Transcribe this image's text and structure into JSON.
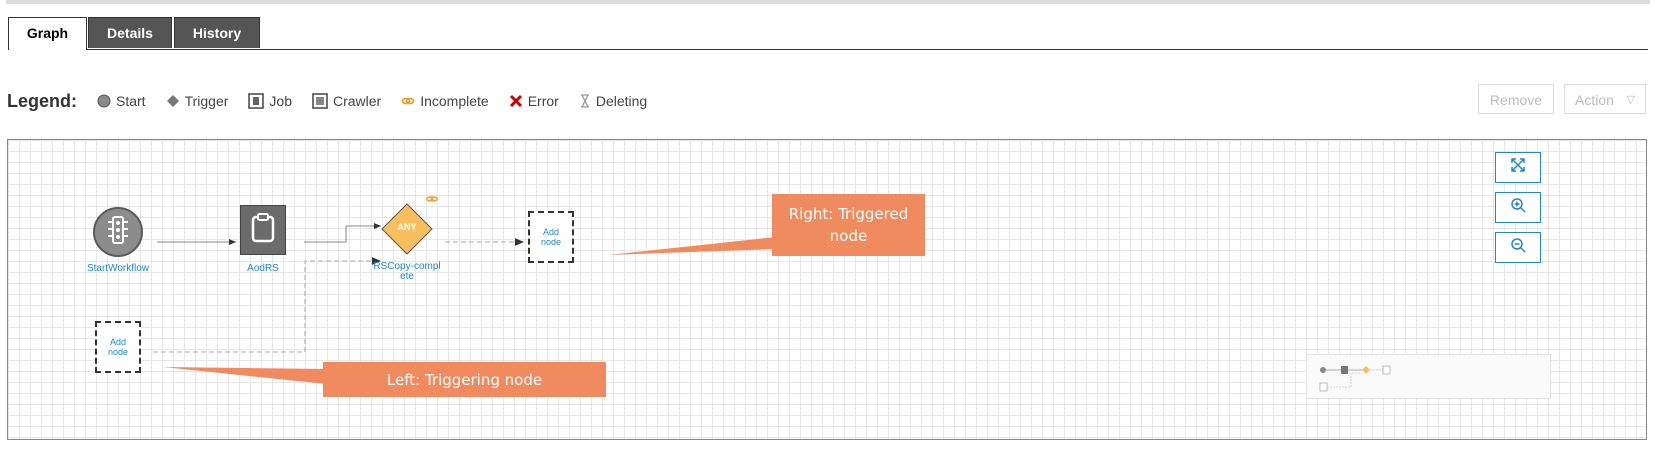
{
  "tabs": [
    {
      "label": "Graph",
      "active": true
    },
    {
      "label": "Details",
      "active": false
    },
    {
      "label": "History",
      "active": false
    }
  ],
  "legend": {
    "title": "Legend:",
    "items": [
      {
        "label": "Start",
        "icon": "start-circle-icon"
      },
      {
        "label": "Trigger",
        "icon": "trigger-diamond-icon"
      },
      {
        "label": "Job",
        "icon": "job-icon"
      },
      {
        "label": "Crawler",
        "icon": "crawler-icon"
      },
      {
        "label": "Incomplete",
        "icon": "incomplete-link-icon"
      },
      {
        "label": "Error",
        "icon": "error-x-icon"
      },
      {
        "label": "Deleting",
        "icon": "hourglass-icon"
      }
    ]
  },
  "toolbar": {
    "remove_label": "Remove",
    "action_label": "Action"
  },
  "graph": {
    "start_node_label": "StartWorkflow",
    "job_node_label": "AodRS",
    "trigger_node_text": "ANY",
    "trigger_node_label_line1": "RSCopy-compl",
    "trigger_node_label_line2": "ete",
    "add_node_label_line1": "Add",
    "add_node_label_line2": "node"
  },
  "callouts": {
    "right": {
      "line1": "Right: Triggered",
      "line2": "node"
    },
    "left": {
      "text": "Left: Triggering node"
    }
  },
  "colors": {
    "accent": "#1e88c8",
    "callout": "#f08a5f",
    "trigger": "#f9bf5e",
    "tab_inactive": "#555555",
    "error": "#cc0000"
  }
}
